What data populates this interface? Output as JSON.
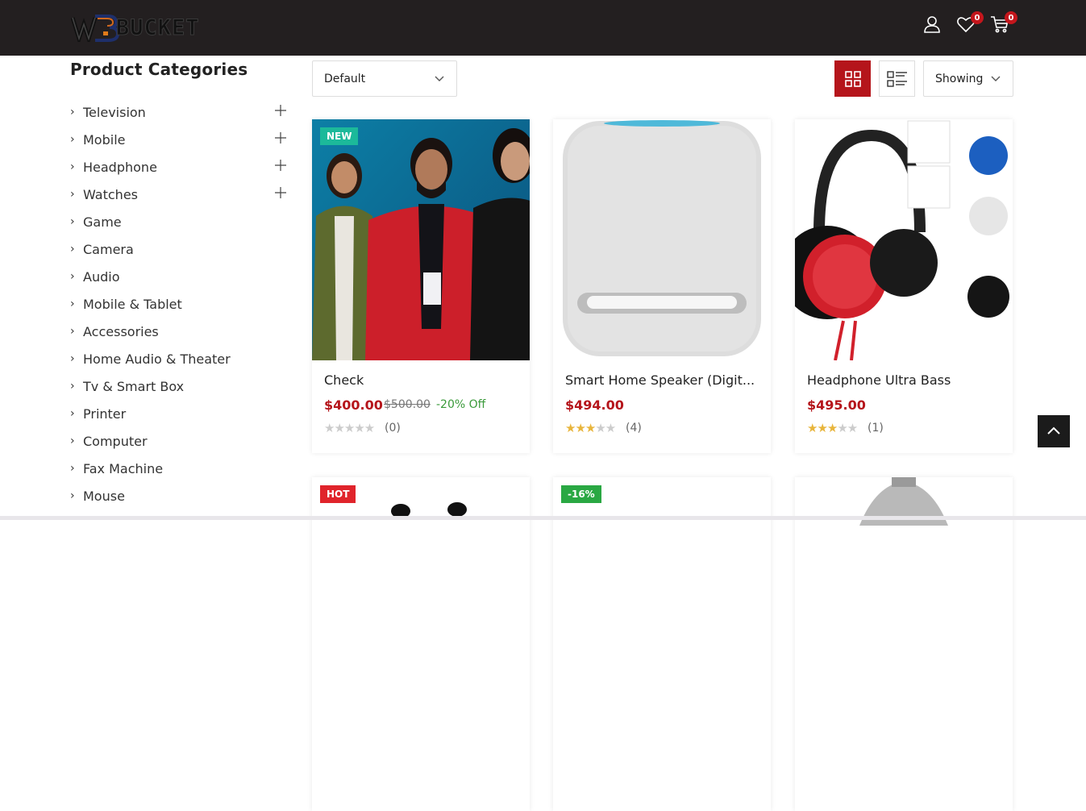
{
  "header": {
    "logo_text": "BUCKET",
    "wishlist_count": "0",
    "cart_count": "0"
  },
  "sidebar": {
    "title": "Product Categories",
    "items": [
      {
        "label": "Television"
      },
      {
        "label": "Mobile"
      },
      {
        "label": "Headphone"
      },
      {
        "label": "Watches"
      },
      {
        "label": "Game"
      },
      {
        "label": "Camera"
      },
      {
        "label": "Audio"
      },
      {
        "label": "Mobile & Tablet"
      },
      {
        "label": "Accessories"
      },
      {
        "label": "Home Audio & Theater"
      },
      {
        "label": "Tv & Smart Box"
      },
      {
        "label": "Printer"
      },
      {
        "label": "Computer"
      },
      {
        "label": "Fax Machine"
      },
      {
        "label": "Mouse"
      }
    ]
  },
  "toolbar": {
    "sort_value": "Default",
    "showing_value": "Showing"
  },
  "products": [
    {
      "badge": "NEW",
      "title": "Check",
      "price": "$400.00",
      "old_price": "$500.00",
      "discount": "-20% Off",
      "rating": 0,
      "reviews": "(0)"
    },
    {
      "title": "Smart Home Speaker (Digit...",
      "price": "$494.00",
      "rating": 2.5,
      "reviews": "(4)"
    },
    {
      "title": "Headphone Ultra Bass",
      "price": "$495.00",
      "rating": 3,
      "reviews": "(1)"
    },
    {
      "badge": "HOT"
    },
    {
      "badge": "-16%"
    },
    {}
  ],
  "colors": {
    "header_bg": "#231f20",
    "accent": "#b5151b",
    "new_badge": "#1cb99a",
    "hot_badge": "#e0242b",
    "sale_badge": "#2aa843"
  },
  "icons": {
    "account": "user-icon",
    "wishlist": "heart-icon",
    "cart": "cart-icon",
    "grid": "grid-view-icon",
    "list": "list-view-icon",
    "to_top": "chevron-up-icon"
  }
}
